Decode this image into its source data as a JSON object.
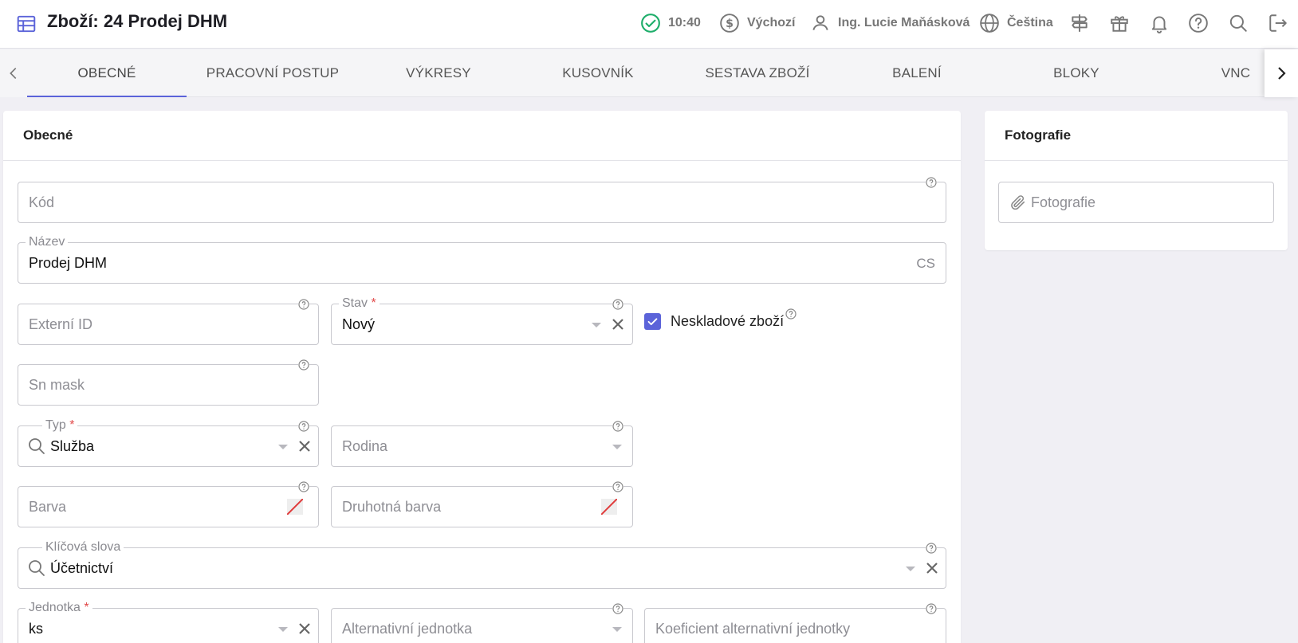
{
  "header": {
    "title": "Zboží: 24 Prodej DHM",
    "time": "10:40",
    "currency": "Výchozí",
    "user": "Ing. Lucie Maňásková",
    "language": "Čeština"
  },
  "tabs": [
    {
      "label": "OBECNÉ"
    },
    {
      "label": "PRACOVNÍ POSTUP"
    },
    {
      "label": "VÝKRESY"
    },
    {
      "label": "KUSOVNÍK"
    },
    {
      "label": "SESTAVA ZBOŽÍ"
    },
    {
      "label": "BALENÍ"
    },
    {
      "label": "BLOKY"
    },
    {
      "label": "VNC"
    }
  ],
  "general": {
    "heading": "Obecné",
    "kod": {
      "placeholder": "Kód"
    },
    "nazev": {
      "label": "Název",
      "value": "Prodej DHM",
      "lang": "CS"
    },
    "externi_id": {
      "placeholder": "Externí ID"
    },
    "stav": {
      "label": "Stav",
      "required": "*",
      "value": "Nový"
    },
    "neskladove": {
      "label": "Neskladové zboží",
      "checked": true
    },
    "sn_mask": {
      "placeholder": "Sn mask"
    },
    "typ": {
      "label": "Typ",
      "required": "*",
      "value": "Služba"
    },
    "rodina": {
      "placeholder": "Rodina"
    },
    "barva": {
      "placeholder": "Barva"
    },
    "druhotna_barva": {
      "placeholder": "Druhotná barva"
    },
    "klicova_slova": {
      "label": "Klíčová slova",
      "value": "Účetnictví"
    },
    "jednotka": {
      "label": "Jednotka",
      "required": "*",
      "value": "ks"
    },
    "alt_jednotka": {
      "placeholder": "Alternativní jednotka"
    },
    "koeficient": {
      "placeholder": "Koeficient alternativní jednotky"
    }
  },
  "photos": {
    "heading": "Fotografie",
    "placeholder": "Fotografie"
  },
  "colors": {
    "accent": "#5b63d9",
    "status_ok": "#1fae6b",
    "required": "#e24a4a"
  }
}
